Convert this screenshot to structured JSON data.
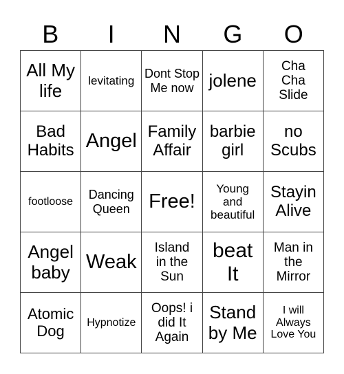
{
  "header": {
    "letters": [
      "B",
      "I",
      "N",
      "G",
      "O"
    ]
  },
  "board": {
    "rows": [
      [
        "All My life",
        "levitating",
        "Dont Stop Me now",
        "jolene",
        "Cha Cha Slide"
      ],
      [
        "Bad Habits",
        "Angel",
        "Family Affair",
        "barbie girl",
        "no Scubs"
      ],
      [
        "footloose",
        "Dancing Queen",
        "Free!",
        "Young and beautiful",
        "Stayin Alive"
      ],
      [
        "Angel baby",
        "Weak",
        "Island in the Sun",
        "beat It",
        "Man in the Mirror"
      ],
      [
        "Atomic Dog",
        "Hypnotize",
        "Oops! i did It Again",
        "Stand by Me",
        "I will Always Love You"
      ]
    ],
    "free_space": "Free!"
  }
}
